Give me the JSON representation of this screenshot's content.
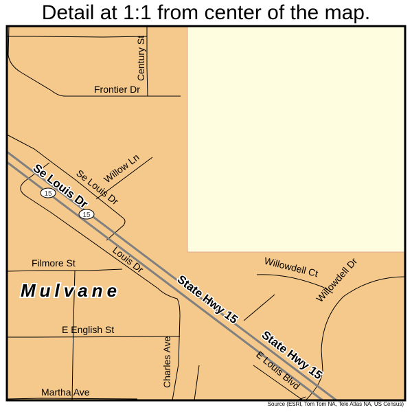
{
  "title": "Detail at 1:1 from center of the map.",
  "source": "Source (ESRI, Tom Tom NA, Tele Atlas NA, US Census)",
  "colors": {
    "land": "#f5c98c",
    "park": "#fffddf",
    "park_border": "#e0a890",
    "road": "#000000",
    "highway": "#808080",
    "frame": "#000000"
  },
  "city_label": "Mulvane",
  "shields": [
    {
      "route": "15"
    },
    {
      "route": "15"
    }
  ],
  "street_labels": {
    "century_st": "Century St",
    "frontier_dr": "Frontier Dr",
    "willow_ln": "Willow Ln",
    "se_louis_dr_minor": "Se Louis Dr",
    "se_louis_dr_major": "Se Louis Dr",
    "louis_dr": "Louis Dr",
    "filmore_st": "Filmore St",
    "state_hwy_15_a": "State Hwy 15",
    "state_hwy_15_b": "State Hwy 15",
    "willowdell_ct": "Willowdell Ct",
    "willowdell_dr": "Willowdell Dr",
    "e_english_st": "E English St",
    "charles_ave": "Charles Ave",
    "e_louis_blvd": "E Louis Blvd",
    "martha_ave": "Martha Ave"
  }
}
